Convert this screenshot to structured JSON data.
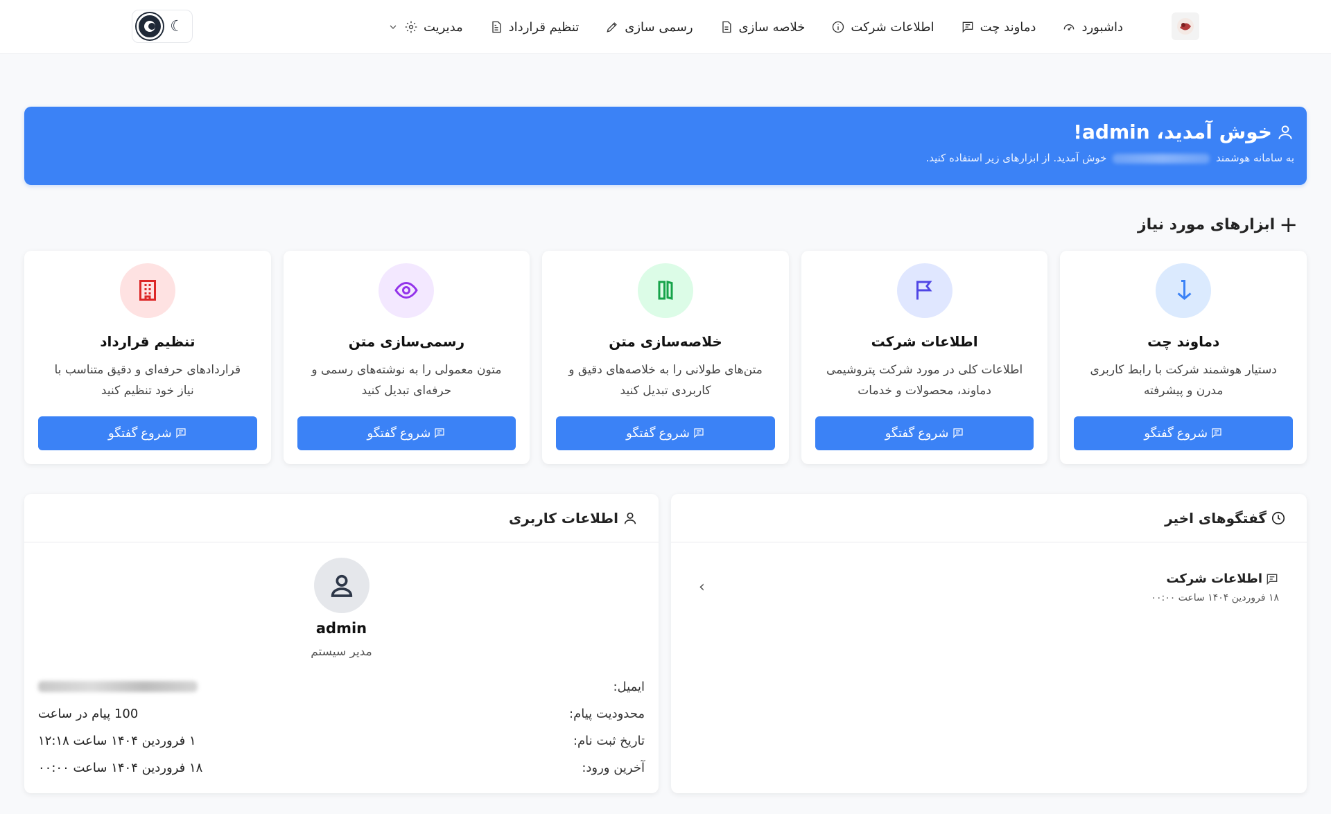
{
  "nav": {
    "items": [
      {
        "label": "داشبورد",
        "icon": "gauge-icon"
      },
      {
        "label": "دماوند چت",
        "icon": "chat-icon"
      },
      {
        "label": "اطلاعات شرکت",
        "icon": "info-icon"
      },
      {
        "label": "خلاصه سازی",
        "icon": "document-icon"
      },
      {
        "label": "رسمی سازی",
        "icon": "pen-icon"
      },
      {
        "label": "تنظیم قرارداد",
        "icon": "file-text-icon"
      },
      {
        "label": "مدیریت",
        "icon": "gear-icon"
      }
    ]
  },
  "banner": {
    "title": "خوش آمدید، admin!",
    "subtitle_prefix": "به سامانه هوشمند",
    "subtitle_suffix": "خوش آمدید. از ابزارهای زیر استفاده کنید."
  },
  "tools": {
    "heading": "ابزارهای مورد نیاز",
    "cards": [
      {
        "title": "دماوند چت",
        "desc": "دستیار هوشمند شرکت با رابط کاربری مدرن و پیشرفته",
        "button": "شروع گفتگو",
        "icon": "arrow-down-icon",
        "color": "#3b82f6",
        "bg": "#dbeafe"
      },
      {
        "title": "اطلاعات شرکت",
        "desc": "اطلاعات کلی در مورد شرکت پتروشیمی دماوند، محصولات و خدمات",
        "button": "شروع گفتگو",
        "icon": "flag-icon",
        "color": "#4f46e5",
        "bg": "#e0e7ff"
      },
      {
        "title": "خلاصه‌سازی متن",
        "desc": "متن‌های طولانی را به خلاصه‌های دقیق و کاربردی تبدیل کنید",
        "button": "شروع گفتگو",
        "icon": "book-icon",
        "color": "#16a34a",
        "bg": "#dcfce7"
      },
      {
        "title": "رسمی‌سازی متن",
        "desc": "متون معمولی را به نوشته‌های رسمی و حرفه‌ای تبدیل کنید",
        "button": "شروع گفتگو",
        "icon": "eye-icon",
        "color": "#9333ea",
        "bg": "#f3e8ff"
      },
      {
        "title": "تنظیم قرارداد",
        "desc": "قراردادهای حرفه‌ای و دقیق متناسب با نیاز خود تنظیم کنید",
        "button": "شروع گفتگو",
        "icon": "building-icon",
        "color": "#dc2626",
        "bg": "#fee2e2"
      }
    ]
  },
  "recent": {
    "title": "گفتگوهای اخیر",
    "items": [
      {
        "title": "اطلاعات شرکت",
        "time": "۱۸ فروردین ۱۴۰۴ ساعت ۰۰:۰۰"
      }
    ]
  },
  "user": {
    "title": "اطلاعات کاربری",
    "name": "admin",
    "role": "مدیر سیستم",
    "rows": [
      {
        "label": "ایمیل:",
        "value": ""
      },
      {
        "label": "محدودیت پیام:",
        "value": "100 پیام در ساعت"
      },
      {
        "label": "تاریخ ثبت نام:",
        "value": "۱ فروردین ۱۴۰۴ ساعت ۱۲:۱۸"
      },
      {
        "label": "آخرین ورود:",
        "value": "۱۸ فروردین ۱۴۰۴ ساعت ۰۰:۰۰"
      }
    ]
  },
  "colors": {
    "primary": "#3b82f6",
    "background": "#f8f9fb"
  }
}
